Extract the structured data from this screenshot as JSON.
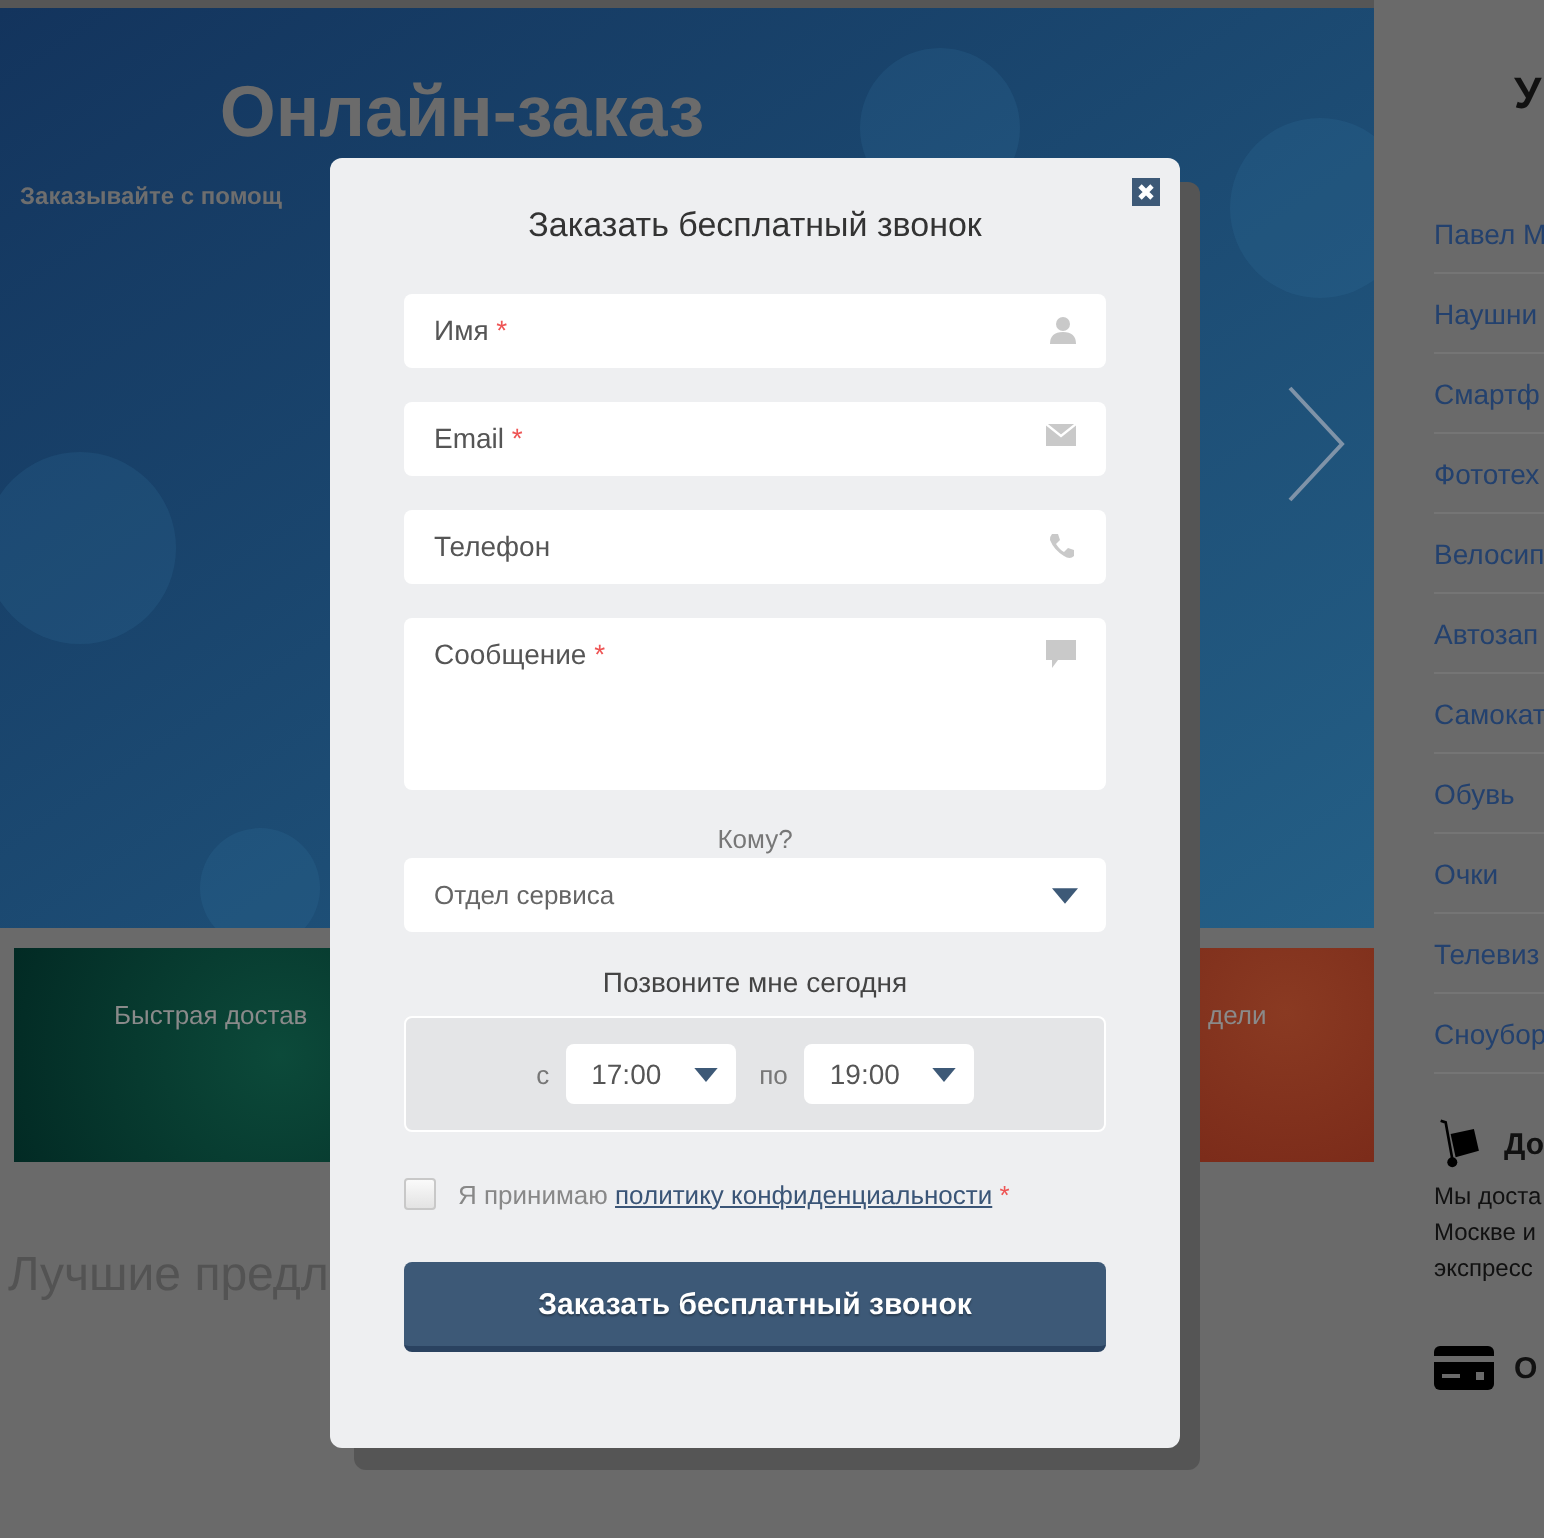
{
  "banner": {
    "title": "Онлайн-заказ",
    "subtitle": "Заказывайте с помощ"
  },
  "promo_tiles": [
    {
      "kind": "green",
      "text": "Быстрая достав"
    },
    {
      "kind": "red",
      "text": "дели"
    }
  ],
  "section_heading": "Лучшие предл",
  "sidebar": {
    "title": "У",
    "links": [
      "Павел М",
      "Наушни",
      "Смартф",
      "Фототех",
      "Велосип",
      "Автозап",
      "Самокат",
      "Обувь",
      "Очки",
      "Телевиз",
      "Сноубор"
    ],
    "info_blocks": [
      {
        "kind": "delivery",
        "title": "До",
        "lines": [
          "Мы доста",
          "Москве и",
          "экспресс"
        ]
      },
      {
        "kind": "payment",
        "title": "О"
      }
    ]
  },
  "dialog": {
    "title": "Заказать бесплатный звонок",
    "fields": [
      {
        "kind": "name",
        "label": "Имя",
        "required_mark": "*"
      },
      {
        "kind": "email",
        "label": "Email",
        "required_mark": "*"
      },
      {
        "kind": "phone",
        "label": "Телефон"
      },
      {
        "kind": "message",
        "label": "Сообщение",
        "required_mark": "*"
      }
    ],
    "recipient_label": "Кому?",
    "recipient": "Отдел сервиса",
    "time_label": "Позвоните мне сегодня",
    "time_from": {
      "prefix": "с",
      "value": "17:00"
    },
    "time_to": {
      "prefix": "по",
      "value": "19:00"
    },
    "consent": {
      "checked": false,
      "text": "Я принимаю",
      "link": "политику конфиденциальности",
      "required_mark": "*"
    },
    "submit": "Заказать бесплатный звонок"
  }
}
